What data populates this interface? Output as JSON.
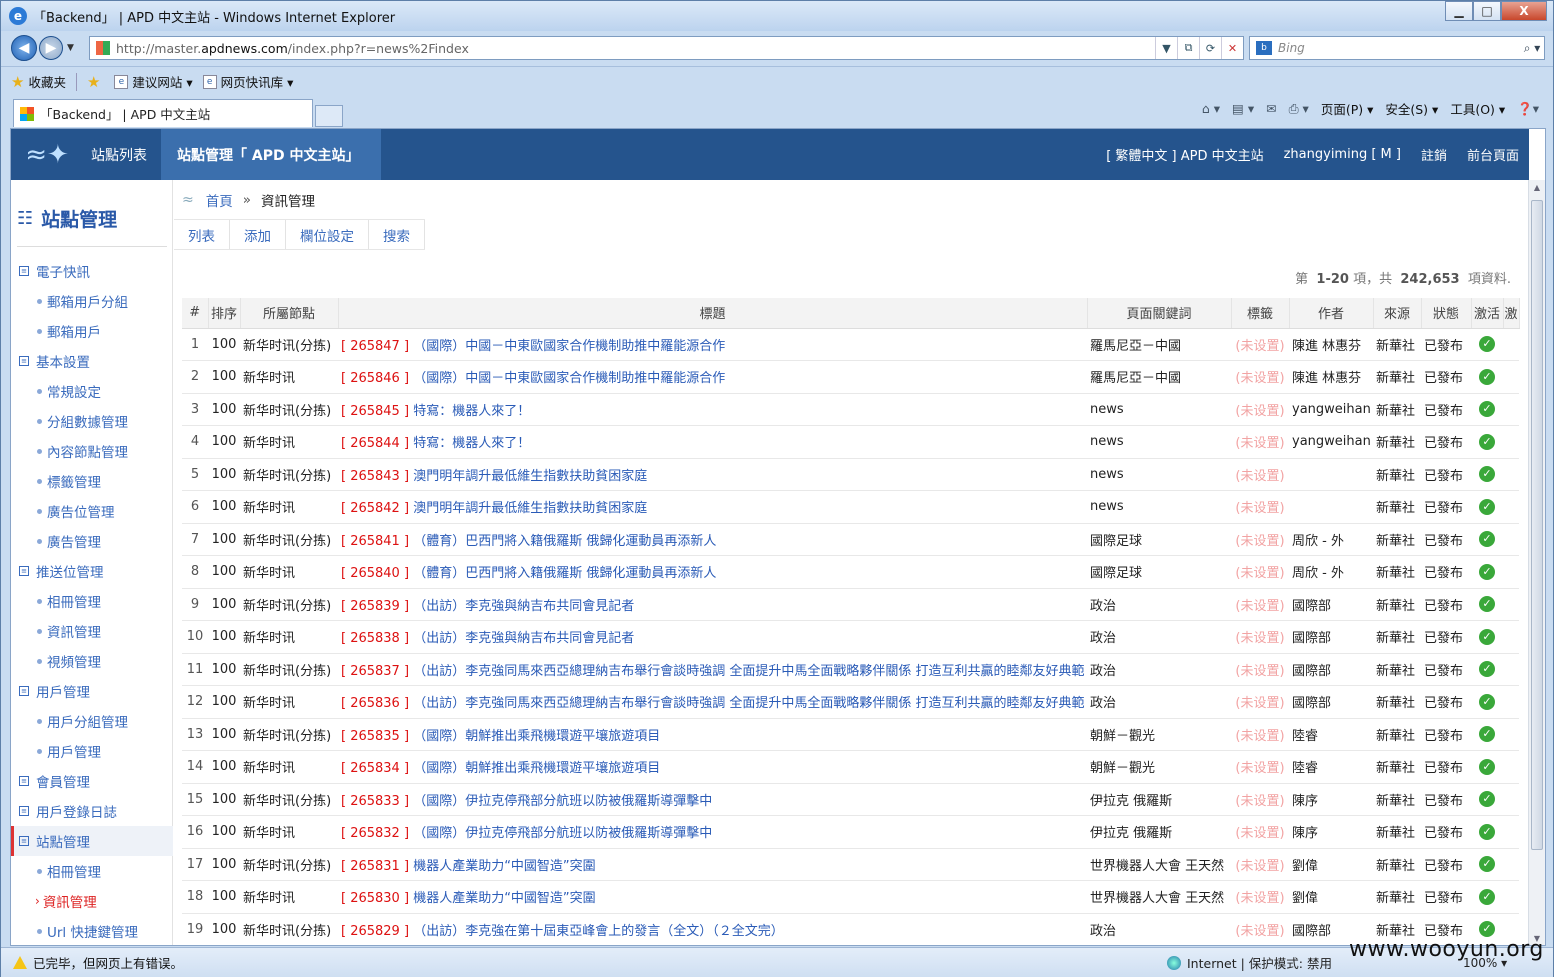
{
  "window": {
    "title": "「Backend」 | APD 中文主站 - Windows Internet Explorer",
    "min": "▁",
    "max": "□",
    "close": "X"
  },
  "address": {
    "url_prefix": "http://master.",
    "url_domain": "apdnews.com",
    "url_rest": "/index.php?r=news%2Findex"
  },
  "search": {
    "placeholder": "Bing"
  },
  "favorites": {
    "label": "收藏夹",
    "items": [
      "建议网站 ▾",
      "网页快讯库 ▾"
    ]
  },
  "tab": {
    "label": "「Backend」 | APD 中文主站"
  },
  "commands": [
    "页面(P) ▾",
    "安全(S) ▾",
    "工具(O) ▾"
  ],
  "app": {
    "nav_site_list": "站點列表",
    "nav_site_admin": "站點管理「 APD 中文主站」",
    "lang": "[ 繁體中文 ] APD 中文主站",
    "user": "zhangyiming [ M ]",
    "logout": "註銷",
    "frontend": "前台頁面"
  },
  "sidebar": {
    "title": "站點管理",
    "items": [
      {
        "label": "電子快訊",
        "type": "group"
      },
      {
        "label": "郵箱用戶分組",
        "type": "sub"
      },
      {
        "label": "郵箱用戶",
        "type": "sub"
      },
      {
        "label": "基本設置",
        "type": "group"
      },
      {
        "label": "常規設定",
        "type": "sub"
      },
      {
        "label": "分組數據管理",
        "type": "sub"
      },
      {
        "label": "內容節點管理",
        "type": "sub"
      },
      {
        "label": "標籤管理",
        "type": "sub"
      },
      {
        "label": "廣告位管理",
        "type": "sub"
      },
      {
        "label": "廣告管理",
        "type": "sub"
      },
      {
        "label": "推送位管理",
        "type": "group"
      },
      {
        "label": "相冊管理",
        "type": "sub"
      },
      {
        "label": "資訊管理",
        "type": "sub"
      },
      {
        "label": "視頻管理",
        "type": "sub"
      },
      {
        "label": "用戶管理",
        "type": "group"
      },
      {
        "label": "用戶分組管理",
        "type": "sub"
      },
      {
        "label": "用戶管理",
        "type": "sub"
      },
      {
        "label": "會員管理",
        "type": "group"
      },
      {
        "label": "用戶登錄日誌",
        "type": "group"
      },
      {
        "label": "站點管理",
        "type": "group-active"
      },
      {
        "label": "相冊管理",
        "type": "sub"
      },
      {
        "label": "資訊管理",
        "type": "sub-current"
      },
      {
        "label": "Url 快捷鍵管理",
        "type": "sub"
      }
    ]
  },
  "breadcrumb": {
    "home": "首頁",
    "sep": "»",
    "current": "資訊管理"
  },
  "tabs": [
    "列表",
    "添加",
    "欄位設定",
    "搜索"
  ],
  "summary": {
    "prefix": "第",
    "range": "1-20",
    "mid": "項，共",
    "total": "242,653",
    "suffix": "項資料."
  },
  "table": {
    "headers": [
      "#",
      "排序",
      "所屬節點",
      "標題",
      "頁面關鍵詞",
      "標籤",
      "作者",
      "來源",
      "狀態",
      "激活",
      "激"
    ],
    "rows": [
      {
        "n": "1",
        "sort": "100",
        "node": "新华时讯(分拣)",
        "id": "[ 265847 ]",
        "title": "（國際）中國－中東歐國家合作機制助推中羅能源合作",
        "kw": "羅馬尼亞－中國",
        "tag": "(未设置)",
        "author": "陳進 林惠芬",
        "src": "新華社",
        "status": "已發布"
      },
      {
        "n": "2",
        "sort": "100",
        "node": "新华时讯",
        "id": "[ 265846 ]",
        "title": "（國際）中國－中東歐國家合作機制助推中羅能源合作",
        "kw": "羅馬尼亞－中國",
        "tag": "(未设置)",
        "author": "陳進 林惠芬",
        "src": "新華社",
        "status": "已發布"
      },
      {
        "n": "3",
        "sort": "100",
        "node": "新华时讯(分拣)",
        "id": "[ 265845 ]",
        "title": "特寫：機器人來了！",
        "kw": "news",
        "tag": "(未设置)",
        "author": "yangweihan",
        "src": "新華社",
        "status": "已發布"
      },
      {
        "n": "4",
        "sort": "100",
        "node": "新华时讯",
        "id": "[ 265844 ]",
        "title": "特寫：機器人來了！",
        "kw": "news",
        "tag": "(未设置)",
        "author": "yangweihan",
        "src": "新華社",
        "status": "已發布"
      },
      {
        "n": "5",
        "sort": "100",
        "node": "新华时讯(分拣)",
        "id": "[ 265843 ]",
        "title": "澳門明年調升最低維生指數扶助貧困家庭",
        "kw": "news",
        "tag": "(未设置)",
        "author": "",
        "src": "新華社",
        "status": "已發布"
      },
      {
        "n": "6",
        "sort": "100",
        "node": "新华时讯",
        "id": "[ 265842 ]",
        "title": "澳門明年調升最低維生指數扶助貧困家庭",
        "kw": "news",
        "tag": "(未设置)",
        "author": "",
        "src": "新華社",
        "status": "已發布"
      },
      {
        "n": "7",
        "sort": "100",
        "node": "新华时讯(分拣)",
        "id": "[ 265841 ]",
        "title": "（體育）巴西門將入籍俄羅斯 俄歸化運動員再添新人",
        "kw": "國際足球",
        "tag": "(未设置)",
        "author": "周欣 - 外",
        "src": "新華社",
        "status": "已發布"
      },
      {
        "n": "8",
        "sort": "100",
        "node": "新华时讯",
        "id": "[ 265840 ]",
        "title": "（體育）巴西門將入籍俄羅斯 俄歸化運動員再添新人",
        "kw": "國際足球",
        "tag": "(未设置)",
        "author": "周欣 - 外",
        "src": "新華社",
        "status": "已發布"
      },
      {
        "n": "9",
        "sort": "100",
        "node": "新华时讯(分拣)",
        "id": "[ 265839 ]",
        "title": "（出訪）李克強與納吉布共同會見記者",
        "kw": "政治",
        "tag": "(未设置)",
        "author": "國際部",
        "src": "新華社",
        "status": "已發布"
      },
      {
        "n": "10",
        "sort": "100",
        "node": "新华时讯",
        "id": "[ 265838 ]",
        "title": "（出訪）李克強與納吉布共同會見記者",
        "kw": "政治",
        "tag": "(未设置)",
        "author": "國際部",
        "src": "新華社",
        "status": "已發布"
      },
      {
        "n": "11",
        "sort": "100",
        "node": "新华时讯(分拣)",
        "id": "[ 265837 ]",
        "title": "（出訪）李克強同馬來西亞總理納吉布舉行會談時強調 全面提升中馬全面戰略夥伴關係 打造互利共贏的睦鄰友好典範",
        "kw": "政治",
        "tag": "(未设置)",
        "author": "國際部",
        "src": "新華社",
        "status": "已發布"
      },
      {
        "n": "12",
        "sort": "100",
        "node": "新华时讯",
        "id": "[ 265836 ]",
        "title": "（出訪）李克強同馬來西亞總理納吉布舉行會談時強調 全面提升中馬全面戰略夥伴關係 打造互利共贏的睦鄰友好典範",
        "kw": "政治",
        "tag": "(未设置)",
        "author": "國際部",
        "src": "新華社",
        "status": "已發布"
      },
      {
        "n": "13",
        "sort": "100",
        "node": "新华时讯(分拣)",
        "id": "[ 265835 ]",
        "title": "（國際）朝鮮推出乘飛機環遊平壤旅遊項目",
        "kw": "朝鮮－觀光",
        "tag": "(未设置)",
        "author": "陸睿",
        "src": "新華社",
        "status": "已發布"
      },
      {
        "n": "14",
        "sort": "100",
        "node": "新华时讯",
        "id": "[ 265834 ]",
        "title": "（國際）朝鮮推出乘飛機環遊平壤旅遊項目",
        "kw": "朝鮮－觀光",
        "tag": "(未设置)",
        "author": "陸睿",
        "src": "新華社",
        "status": "已發布"
      },
      {
        "n": "15",
        "sort": "100",
        "node": "新华时讯(分拣)",
        "id": "[ 265833 ]",
        "title": "（國際）伊拉克停飛部分航班以防被俄羅斯導彈擊中",
        "kw": "伊拉克 俄羅斯",
        "tag": "(未设置)",
        "author": "陳序",
        "src": "新華社",
        "status": "已發布"
      },
      {
        "n": "16",
        "sort": "100",
        "node": "新华时讯",
        "id": "[ 265832 ]",
        "title": "（國際）伊拉克停飛部分航班以防被俄羅斯導彈擊中",
        "kw": "伊拉克 俄羅斯",
        "tag": "(未设置)",
        "author": "陳序",
        "src": "新華社",
        "status": "已發布"
      },
      {
        "n": "17",
        "sort": "100",
        "node": "新华时讯(分拣)",
        "id": "[ 265831 ]",
        "title": "機器人產業助力“中國智造”突圍",
        "kw": "世界機器人大會 王天然",
        "tag": "(未设置)",
        "author": "劉偉",
        "src": "新華社",
        "status": "已發布"
      },
      {
        "n": "18",
        "sort": "100",
        "node": "新华时讯",
        "id": "[ 265830 ]",
        "title": "機器人產業助力“中國智造”突圍",
        "kw": "世界機器人大會 王天然",
        "tag": "(未设置)",
        "author": "劉偉",
        "src": "新華社",
        "status": "已發布"
      },
      {
        "n": "19",
        "sort": "100",
        "node": "新华时讯(分拣)",
        "id": "[ 265829 ]",
        "title": "（出訪）李克強在第十屆東亞峰會上的發言（全文）（２全文完）",
        "kw": "政治",
        "tag": "(未设置)",
        "author": "國際部",
        "src": "新華社",
        "status": "已發布"
      }
    ]
  },
  "status": {
    "text": "已完毕，但网页上有错误。",
    "zone": "Internet | 保护模式: 禁用",
    "zoom": "100% ▾"
  },
  "watermark": "www.wooyun.org"
}
